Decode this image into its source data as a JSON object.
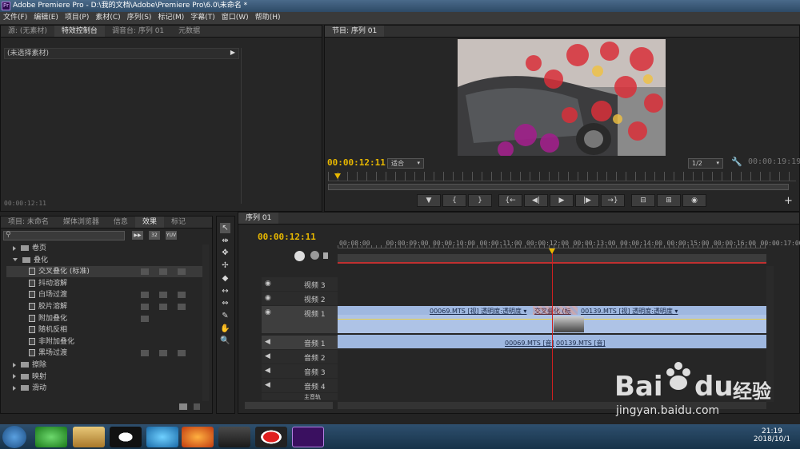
{
  "window": {
    "title": "Adobe Premiere Pro - D:\\我的文档\\Adobe\\Premiere Pro\\6.0\\未命名 *",
    "logo": "Pr"
  },
  "menu": [
    "文件(F)",
    "编辑(E)",
    "项目(P)",
    "素材(C)",
    "序列(S)",
    "标记(M)",
    "字幕(T)",
    "窗口(W)",
    "帮助(H)"
  ],
  "source_panel": {
    "tabs": [
      "源: (无素材)",
      "特效控制台",
      "调音台: 序列 01",
      "元数据"
    ],
    "no_clip_text": "(未选择素材)",
    "timecode": "00:00:12:11"
  },
  "program_monitor": {
    "tab": "节目: 序列 01",
    "current_timecode": "00:00:12:11",
    "fit_label": "适合",
    "resolution_label": "1/2",
    "duration_timecode": "00:00:19:19",
    "controls": [
      "▼",
      "{",
      "}",
      "{←",
      "◀|",
      "▶",
      "|▶",
      "→}",
      "⊟",
      "⊞",
      "◉"
    ]
  },
  "project_panel": {
    "tabs": [
      "项目: 未命名",
      "媒体浏览器",
      "信息",
      "效果",
      "标记"
    ],
    "search_placeholder": "",
    "tool_badges": [
      "▶▶",
      "32",
      "YUV"
    ],
    "items": [
      {
        "label": "卷页",
        "type": "folder",
        "level": 1,
        "expanded": false
      },
      {
        "label": "叠化",
        "type": "folder",
        "level": 1,
        "expanded": true
      },
      {
        "label": "交叉叠化 (标准)",
        "type": "effect",
        "level": 2,
        "selected": true,
        "badges": 3
      },
      {
        "label": "抖动溶解",
        "type": "effect",
        "level": 2,
        "badges": 0
      },
      {
        "label": "白场过渡",
        "type": "effect",
        "level": 2,
        "badges": 3
      },
      {
        "label": "胶片溶解",
        "type": "effect",
        "level": 2,
        "badges": 3
      },
      {
        "label": "附加叠化",
        "type": "effect",
        "level": 2,
        "badges": 1
      },
      {
        "label": "随机反相",
        "type": "effect",
        "level": 2,
        "badges": 0
      },
      {
        "label": "非附加叠化",
        "type": "effect",
        "level": 2,
        "badges": 0
      },
      {
        "label": "黑场过渡",
        "type": "effect",
        "level": 2,
        "badges": 3
      },
      {
        "label": "擦除",
        "type": "folder",
        "level": 1,
        "expanded": false
      },
      {
        "label": "映射",
        "type": "folder",
        "level": 1,
        "expanded": false
      },
      {
        "label": "滑动",
        "type": "folder",
        "level": 1,
        "expanded": false
      }
    ]
  },
  "tools": [
    "↖",
    "⇹",
    "✥",
    "✢",
    "◆",
    "↔",
    "⇔",
    "✎",
    "✋",
    "🔍"
  ],
  "timeline": {
    "tab": "序列 01",
    "timecode": "00:00:12:11",
    "ruler": [
      "00:08:00",
      "00:00:09:00",
      "00:00:10:00",
      "00:00:11:00",
      "00:00:12:00",
      "00:00:13:00",
      "00:00:14:00",
      "00:00:15:00",
      "00:00:16:00",
      "00:00:17:00"
    ],
    "video_tracks": [
      "视频 3",
      "视频 2",
      "视频 1"
    ],
    "audio_tracks": [
      "音频 1",
      "音频 2",
      "音频 3",
      "音频 4",
      "主音轨"
    ],
    "video_clips": [
      {
        "label": "00069.MTS [视] 透明度:透明度 ▾"
      },
      {
        "label": "交叉叠化 (标"
      },
      {
        "label": "00139.MTS [视] 透明度:透明度 ▾"
      }
    ],
    "audio_clips": [
      {
        "label": "00069.MTS [音]"
      },
      {
        "label": "00139.MTS [音]"
      }
    ]
  },
  "watermark": {
    "brand": "Bai",
    "brand2": "du",
    "brand_cn": "经验",
    "url": "jingyan.baidu.com"
  },
  "taskbar": {
    "time": "21:19",
    "date": "2018/10/1"
  },
  "colors": {
    "accent_yellow": "#e8b800",
    "clip_blue": "#9fb8e0",
    "playhead": "#d02020"
  }
}
